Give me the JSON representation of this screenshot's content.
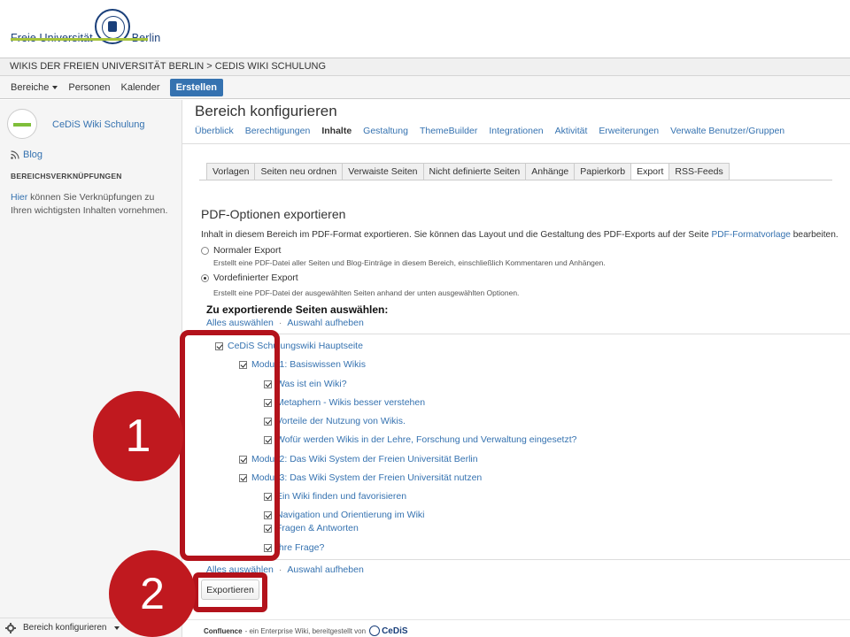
{
  "logo": {
    "left_text": "Freie Universität",
    "right_text": "Berlin"
  },
  "breadcrumb": "WIKIS DER FREIEN UNIVERSITÄT BERLIN > CEDIS WIKI SCHULUNG",
  "topnav": {
    "spaces": "Bereiche",
    "people": "Personen",
    "calendar": "Kalender",
    "create": "Erstellen"
  },
  "sidebar": {
    "space_name": "CeDiS Wiki Schulung",
    "blog": "Blog",
    "section_heading": "BEREICHSVERKNÜPFUNGEN",
    "hint_link": "Hier",
    "hint_text": " können Sie Verknüpfungen zu Ihren wichtigsten Inhalten vornehmen.",
    "footer_label": "Bereich konfigurieren",
    "collapse_glyph": "«"
  },
  "page": {
    "title": "Bereich konfigurieren",
    "config_tabs": [
      "Überblick",
      "Berechtigungen",
      "Inhalte",
      "Gestaltung",
      "ThemeBuilder",
      "Integrationen",
      "Aktivität",
      "Erweiterungen",
      "Verwalte Benutzer/Gruppen"
    ],
    "active_config_tab": "Inhalte",
    "sub_tabs": [
      "Vorlagen",
      "Seiten neu ordnen",
      "Verwaiste Seiten",
      "Nicht definierte Seiten",
      "Anhänge",
      "Papierkorb",
      "Export",
      "RSS-Feeds"
    ],
    "active_sub_tab": "Export"
  },
  "pdf": {
    "title": "PDF-Optionen exportieren",
    "desc_before": "Inhalt in diesem Bereich im PDF-Format exportieren. Sie können das Layout und die Gestaltung des PDF-Exports auf der Seite ",
    "desc_link": "PDF-Formatvorlage",
    "desc_after": " bearbeiten.",
    "normal_label": "Normaler Export",
    "normal_help": "Erstellt eine PDF-Datei aller Seiten und Blog-Einträge in diesem Bereich, einschließlich Kommentaren und Anhängen.",
    "predef_label": "Vordefinierter Export",
    "predef_help": "Erstellt eine PDF-Datei der ausgewählten Seiten anhand der unten ausgewählten Optionen.",
    "selected_option": "Vordefinierter Export",
    "select_heading": "Zu exportierende Seiten auswählen:",
    "select_all": "Alles auswählen",
    "deselect_all": "Auswahl aufheben",
    "separator": "·",
    "pages": [
      "CeDiS Schulungswiki Hauptseite",
      "Modul 1: Basiswissen Wikis",
      "Was ist ein Wiki?",
      "Metaphern - Wikis besser verstehen",
      "Vorteile der Nutzung von Wikis.",
      "Wofür werden Wikis in der Lehre, Forschung und Verwaltung eingesetzt?",
      "Modul 2: Das Wiki System der Freien Universität Berlin",
      "Modul 3: Das Wiki System der Freien Universität nutzen",
      "Ein Wiki finden und favorisieren",
      "Navigation und Orientierung im Wiki",
      "Fragen & Antworten",
      "Ihre Frage?"
    ],
    "export_button": "Exportieren"
  },
  "footer": {
    "product": "Confluence",
    "text": "- ein Enterprise Wiki, bereitgestellt von",
    "brand": "CeDiS"
  },
  "annotations": {
    "step1": "1",
    "step2": "2",
    "color": "#c0191f"
  }
}
